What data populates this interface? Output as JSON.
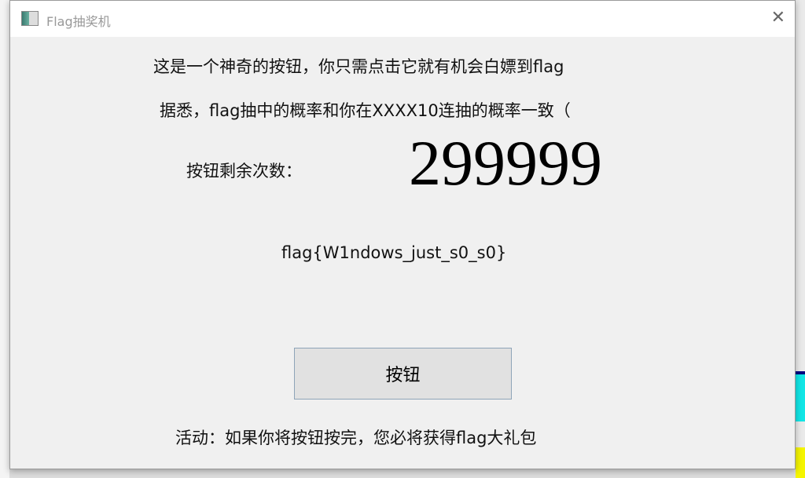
{
  "window": {
    "title": "Flag抽奖机"
  },
  "main": {
    "line1": "这是一个神奇的按钮，你只需点击它就有机会白嫖到flag",
    "line2": "据悉，flag抽中的概率和你在XXXX10连抽的概率一致（",
    "remaining_label": "按钮剩余次数：",
    "remaining_count": "299999",
    "flag": "flag{W1ndows_just_s0_s0}",
    "button_label": "按钮",
    "activity": "活动：如果你将按钮按完，您必将获得flag大礼包"
  }
}
